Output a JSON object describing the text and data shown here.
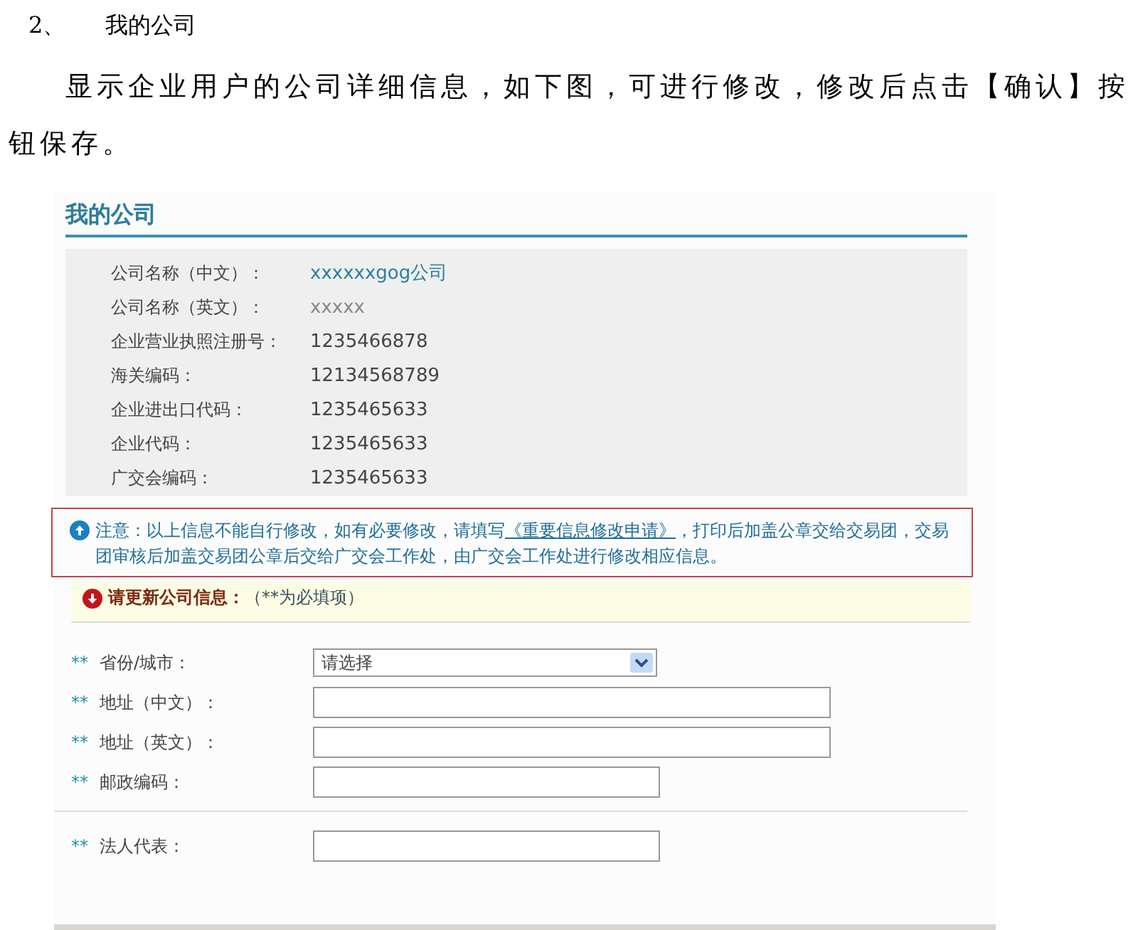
{
  "section": {
    "number": "2、",
    "title": "我的公司"
  },
  "intro": "显示企业用户的公司详细信息，如下图，可进行修改，修改后点击【确认】按钮保存。",
  "panel": {
    "title": "我的公司",
    "info": [
      {
        "label": "公司名称（中文）：",
        "value": "xxxxxxgog公司",
        "kind": "link"
      },
      {
        "label": "公司名称（英文）：",
        "value": "xxxxx",
        "kind": "muted"
      },
      {
        "label": "企业营业执照注册号：",
        "value": "1235466878",
        "kind": "plain"
      },
      {
        "label": "海关编码：",
        "value": "12134568789",
        "kind": "plain"
      },
      {
        "label": "企业进出口代码：",
        "value": "1235465633",
        "kind": "plain"
      },
      {
        "label": "企业代码：",
        "value": "1235465633",
        "kind": "plain"
      },
      {
        "label": "广交会编码：",
        "value": "1235465633",
        "kind": "plain"
      }
    ],
    "notice": {
      "before": "注意：以上信息不能自行修改，如有必要修改，请填写",
      "link": "《重要信息修改申请》",
      "after": "，打印后加盖公章交给交易团，交易团审核后加盖交易团公章后交给广交会工作处，由广交会工作处进行修改相应信息。"
    },
    "update_hint": {
      "label": "请更新公司信息：",
      "note": "（**为必填项）"
    },
    "groups": [
      [
        {
          "mark": "**",
          "label": "省份/城市：",
          "kind": "select",
          "value": "请选择"
        },
        {
          "mark": "**",
          "label": "地址（中文）：",
          "kind": "long_input"
        },
        {
          "mark": "**",
          "label": "地址（英文）：",
          "kind": "long_input"
        },
        {
          "mark": "**",
          "label": "邮政编码：",
          "kind": "short_input"
        }
      ],
      [
        {
          "mark": "**",
          "label": "法人代表：",
          "kind": "short_input"
        }
      ]
    ]
  }
}
